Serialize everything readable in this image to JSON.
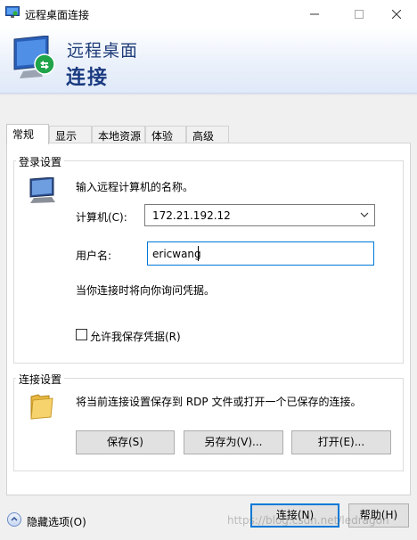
{
  "window": {
    "title": "远程桌面连接",
    "controls": {
      "minimize": "min-icon",
      "maximize": "max-icon",
      "close": "close-icon"
    }
  },
  "banner": {
    "line1": "远程桌面",
    "line2": "连接"
  },
  "tabs": [
    {
      "label": "常规",
      "active": true
    },
    {
      "label": "显示",
      "active": false
    },
    {
      "label": "本地资源",
      "active": false
    },
    {
      "label": "体验",
      "active": false
    },
    {
      "label": "高级",
      "active": false
    }
  ],
  "login": {
    "group_label": "登录设置",
    "prompt": "输入远程计算机的名称。",
    "computer_label": "计算机(C):",
    "computer_value": "172.21.192.12",
    "username_label": "用户名:",
    "username_value": "ericwang",
    "notice": "当你连接时将向你询问凭据。",
    "save_credentials_label": "允许我保存凭据(R)",
    "save_credentials_checked": false
  },
  "connection": {
    "group_label": "连接设置",
    "description": "将当前连接设置保存到 RDP 文件或打开一个已保存的连接。",
    "save_button": "保存(S)",
    "save_as_button": "另存为(V)...",
    "open_button": "打开(E)..."
  },
  "footer": {
    "hide_options": "隐藏选项(O)",
    "connect_button": "连接(N)",
    "help_button": "帮助(H)",
    "watermark": "https://blog.csdn.net/ledragon"
  },
  "colors": {
    "accent": "#0078d7",
    "banner_text": "#1e3c78"
  }
}
